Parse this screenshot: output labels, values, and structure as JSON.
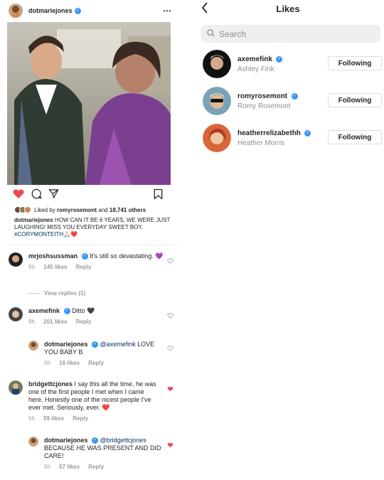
{
  "post": {
    "username": "dotmariejones",
    "more_icon": "⋯",
    "liked_by_prefix": "Liked by",
    "liked_by_user": "romyrosemont",
    "liked_by_and": "and",
    "liked_by_count": "18,741 others",
    "caption_user": "dotmariejones",
    "caption_text": "HOW CAN IT BE 6 YEARS, WE WERE JUST LAUGHING! MISS YOU EVERYDAY SWEET BOY.",
    "caption_hashtag": "#CORYMONTEITH",
    "caption_emoji": "🙏🏻❤️"
  },
  "comments": [
    {
      "user": "mrjoshsussman",
      "verified": true,
      "text": "It's still so devastating.",
      "emoji": "💜",
      "time": "9h",
      "likes": "145 likes",
      "reply": "Reply",
      "liked": false
    },
    {
      "user": "axemefink",
      "verified": true,
      "text": "Ditto",
      "emoji": "🖤",
      "time": "9h",
      "likes": "201 likes",
      "reply": "Reply",
      "liked": false
    },
    {
      "user": "dotmariejones",
      "verified": true,
      "mention": "@axemefink",
      "text": "LOVE YOU BABY B",
      "time": "5h",
      "likes": "16 likes",
      "reply": "Reply",
      "liked": false
    },
    {
      "user": "bridgettcjones",
      "verified": false,
      "text": "I say this all the time, he was one of the first people I met when I came here. Honestly one of the nicest people I've ever met. Seriously, ever.",
      "emoji": "❤️",
      "time": "5h",
      "likes": "59 likes",
      "reply": "Reply",
      "liked": true
    },
    {
      "user": "dotmariejones",
      "verified": true,
      "mention": "@bridgettcjones",
      "text": "BECAUSE HE WAS PRESENT AND DID CARE!",
      "time": "5h",
      "likes": "57 likes",
      "reply": "Reply",
      "liked": true
    }
  ],
  "view_replies": "View replies (1)",
  "likes_panel": {
    "back_icon": "<",
    "title": "Likes",
    "search_placeholder": "Search",
    "rows": [
      {
        "username": "axemefink",
        "name": "Ashley Fink",
        "button": "Following"
      },
      {
        "username": "romyrosemont",
        "name": "Romy Rosemont",
        "button": "Following"
      },
      {
        "username": "heatherrelizabethh",
        "name": "Heather Morris",
        "button": "Following"
      }
    ]
  },
  "colors": {
    "verified": "#3897f0",
    "like_red": "#ed4956",
    "hashtag": "#003569",
    "muted": "#8e8e8e"
  },
  "icons": [
    "heart-filled-icon",
    "comment-icon",
    "share-icon",
    "bookmark-icon",
    "search-icon",
    "verified-icon",
    "chevron-left-icon",
    "more-icon"
  ]
}
